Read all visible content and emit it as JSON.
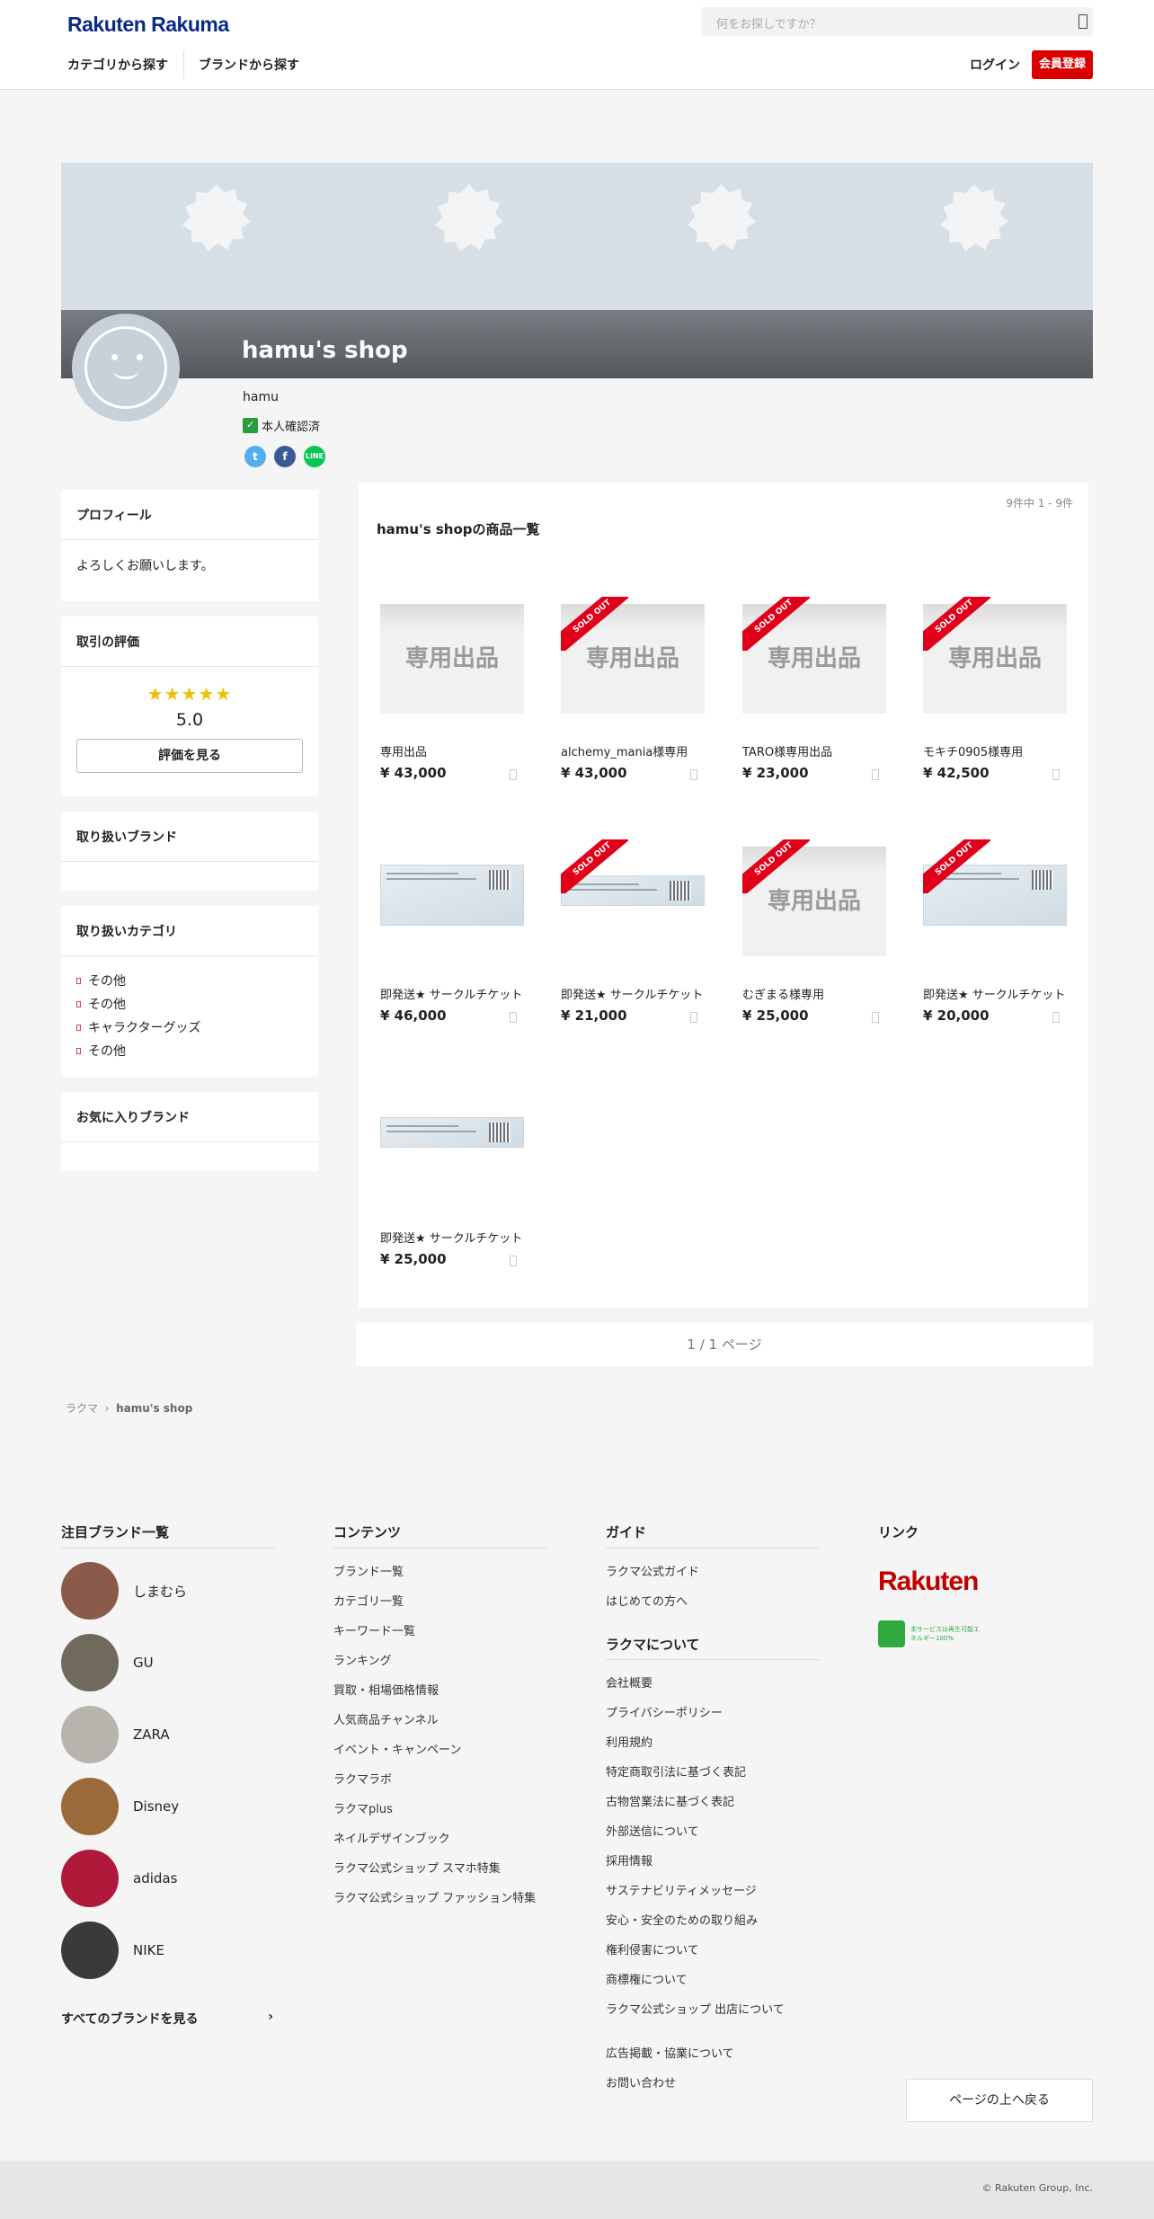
{
  "header": {
    "logo": "Rakuten Rakuma",
    "search_placeholder": "何をお探しですか？",
    "nav": [
      "カテゴリから探す",
      "ブランドから探す"
    ],
    "login": "ログイン",
    "register": "会員登録"
  },
  "shop": {
    "name": "hamu's shop",
    "owner": "hamu",
    "verified": "本人確認済"
  },
  "sidebar": {
    "profile_title": "プロフィール",
    "profile_text": "よろしくお願いします。",
    "rating_title": "取引の評価",
    "stars": "★★★★★",
    "rating": "5.0",
    "rating_button": "評価を見る",
    "brands_title": "取り扱いブランド",
    "categories_title": "取り扱いカテゴリ",
    "categories": [
      "その他",
      "その他",
      "キャラクターグッズ",
      "その他"
    ],
    "fav_brands_title": "お気に入りブランド"
  },
  "products": {
    "count": "9件中 1 - 9件",
    "title": "hamu's shopの商品一覧",
    "placeholder_text": "専用出品",
    "sold_label": "SOLD OUT",
    "items": [
      {
        "name": "専用出品",
        "price": "¥ 43,000",
        "sold": false,
        "img": "placeholder"
      },
      {
        "name": "alchemy_mania様専用",
        "price": "¥ 43,000",
        "sold": true,
        "img": "placeholder"
      },
      {
        "name": "TARO様専用出品",
        "price": "¥ 23,000",
        "sold": true,
        "img": "placeholder"
      },
      {
        "name": "モキチ0905様専用",
        "price": "¥ 42,500",
        "sold": true,
        "img": "placeholder"
      },
      {
        "name": "即発送★ サークルチケット",
        "price": "¥ 46,000",
        "sold": false,
        "img": "ticket"
      },
      {
        "name": "即発送★ サークルチケット",
        "price": "¥ 21,000",
        "sold": true,
        "img": "ticket"
      },
      {
        "name": "むぎまる様専用",
        "price": "¥ 25,000",
        "sold": true,
        "img": "placeholder"
      },
      {
        "name": "即発送★ サークルチケット",
        "price": "¥ 20,000",
        "sold": true,
        "img": "ticket"
      },
      {
        "name": "即発送★ サークルチケット",
        "price": "¥ 25,000",
        "sold": false,
        "img": "ticket"
      }
    ],
    "pager": "1 / 1 ページ"
  },
  "breadcrumb": [
    "ラクマ",
    "hamu's shop"
  ],
  "footer": {
    "brands_title": "注目ブランド一覧",
    "brands": [
      {
        "name": "しまむら",
        "color": "#8a5a4a"
      },
      {
        "name": "GU",
        "color": "#6f6a5c"
      },
      {
        "name": "ZARA",
        "color": "#b8b3ad"
      },
      {
        "name": "Disney",
        "color": "#9b6a3a"
      },
      {
        "name": "adidas",
        "color": "#b01a3a"
      },
      {
        "name": "NIKE",
        "color": "#3a3a3a"
      }
    ],
    "all_brands": "すべてのブランドを見る",
    "contents_title": "コンテンツ",
    "contents": [
      "ブランド一覧",
      "カテゴリ一覧",
      "キーワード一覧",
      "ランキング",
      "買取・相場価格情報",
      "人気商品チャンネル",
      "イベント・キャンペーン",
      "ラクマラボ",
      "ラクマplus",
      "ネイルデザインブック",
      "ラクマ公式ショップ スマホ特集",
      "ラクマ公式ショップ ファッション特集"
    ],
    "guide_title": "ガイド",
    "guide": [
      "ラクマ公式ガイド",
      "はじめての方へ"
    ],
    "about_title": "ラクマについて",
    "about": [
      "会社概要",
      "プライバシーポリシー",
      "利用規約",
      "特定商取引法に基づく表記",
      "古物営業法に基づく表記",
      "外部送信について",
      "採用情報",
      "サステナビリティメッセージ",
      "安心・安全のための取り組み",
      "権利侵害について",
      "商標権について",
      "ラクマ公式ショップ 出店について",
      "広告掲載・協業について",
      "お問い合わせ"
    ],
    "links_title": "リンク",
    "rakuten_logo": "Rakuten",
    "green_text": "本サービスは再生可能エネルギー100%",
    "back_top": "ページの上へ戻る",
    "copyright": "© Rakuten Group, Inc."
  }
}
